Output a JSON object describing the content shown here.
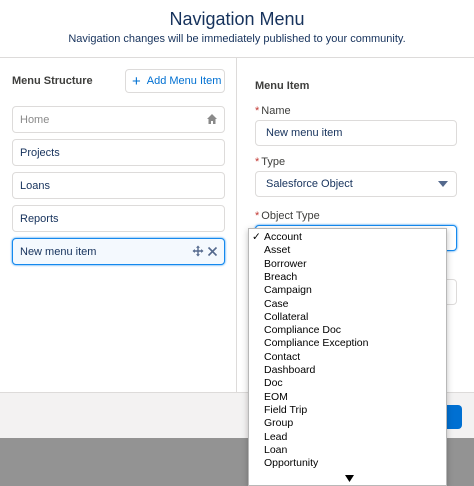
{
  "header": {
    "title": "Navigation Menu",
    "subtitle": "Navigation changes will be immediately published to your community."
  },
  "left": {
    "section_title": "Menu Structure",
    "add_label": "Add Menu Item",
    "items": [
      {
        "label": "Home"
      },
      {
        "label": "Projects"
      },
      {
        "label": "Loans"
      },
      {
        "label": "Reports"
      },
      {
        "label": "New menu item"
      }
    ]
  },
  "right": {
    "section_title": "Menu Item",
    "name_label": "Name",
    "name_value": "New menu item",
    "type_label": "Type",
    "type_value": "Salesforce Object",
    "object_type_label": "Object Type",
    "required_mark": "*"
  },
  "dropdown": {
    "selected": "Account",
    "options": [
      "Account",
      "Asset",
      "Borrower",
      "Breach",
      "Campaign",
      "Case",
      "Collateral",
      "Compliance Doc",
      "Compliance Exception",
      "Contact",
      "Dashboard",
      "Doc",
      "EOM",
      "Field Trip",
      "Group",
      "Lead",
      "Loan",
      "Opportunity"
    ]
  },
  "colors": {
    "accent": "#0070d2",
    "focus": "#1589ee",
    "required": "#c23934",
    "text": "#16325c"
  },
  "icons": {
    "add": "plus-icon",
    "home": "home-icon",
    "move": "move-icon",
    "delete": "close-icon",
    "caret": "caret-down-icon",
    "check": "checkmark-icon",
    "scroll": "scroll-down-icon"
  }
}
